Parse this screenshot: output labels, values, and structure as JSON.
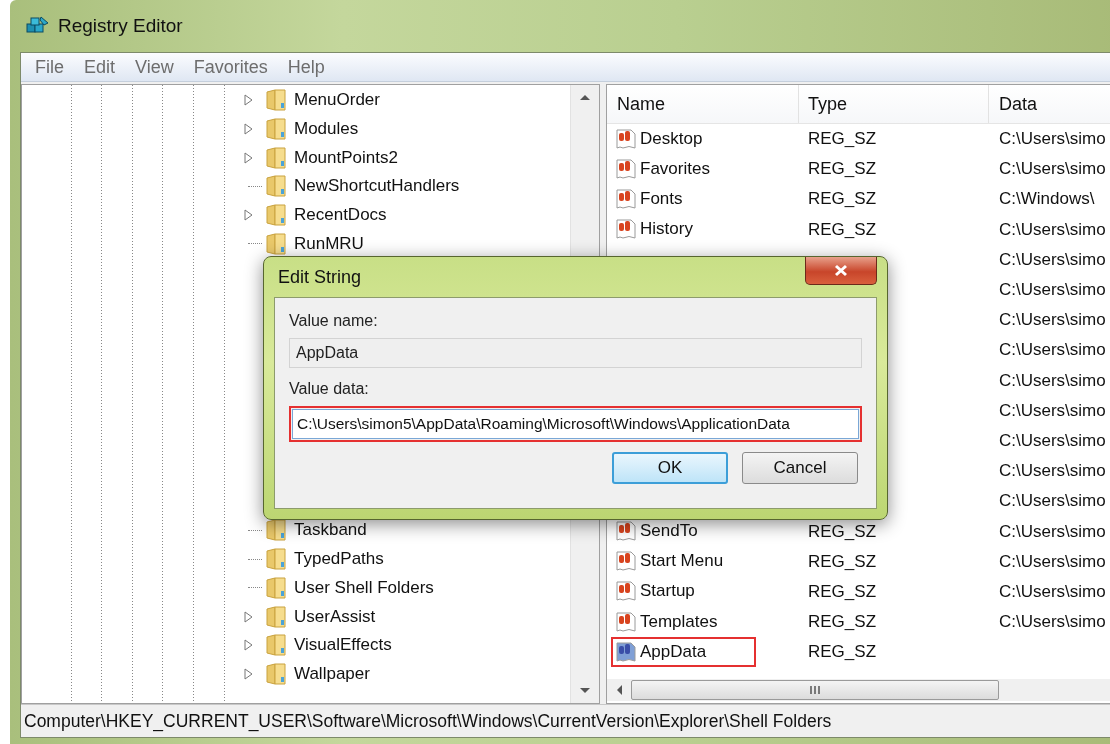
{
  "window": {
    "title": "Registry Editor"
  },
  "menu": [
    {
      "label": "File"
    },
    {
      "label": "Edit"
    },
    {
      "label": "View"
    },
    {
      "label": "Favorites"
    },
    {
      "label": "Help"
    }
  ],
  "tree": {
    "items_above": [
      {
        "label": "MenuOrder",
        "expandable": true
      },
      {
        "label": "Modules",
        "expandable": true
      },
      {
        "label": "MountPoints2",
        "expandable": true
      },
      {
        "label": "NewShortcutHandlers",
        "expandable": false
      },
      {
        "label": "RecentDocs",
        "expandable": true
      },
      {
        "label": "RunMRU",
        "expandable": false
      }
    ],
    "items_below": [
      {
        "label": "Taskband",
        "expandable": false
      },
      {
        "label": "TypedPaths",
        "expandable": false
      },
      {
        "label": "User Shell Folders",
        "expandable": false
      },
      {
        "label": "UserAssist",
        "expandable": true
      },
      {
        "label": "VisualEffects",
        "expandable": true
      },
      {
        "label": "Wallpaper",
        "expandable": true
      }
    ]
  },
  "list": {
    "columns": [
      "Name",
      "Type",
      "Data"
    ],
    "rows": [
      {
        "name": "Desktop",
        "type": "REG_SZ",
        "data": "C:\\Users\\simo",
        "selected": false,
        "highlighted": false
      },
      {
        "name": "Favorites",
        "type": "REG_SZ",
        "data": "C:\\Users\\simo",
        "selected": false,
        "highlighted": false
      },
      {
        "name": "Fonts",
        "type": "REG_SZ",
        "data": "C:\\Windows\\",
        "selected": false,
        "highlighted": false
      },
      {
        "name": "History",
        "type": "REG_SZ",
        "data": "C:\\Users\\simo",
        "selected": false,
        "highlighted": false
      },
      {
        "data": "C:\\Users\\simo"
      },
      {
        "data": "C:\\Users\\simo"
      },
      {
        "data": "C:\\Users\\simo"
      },
      {
        "data": "C:\\Users\\simo"
      },
      {
        "data": "C:\\Users\\simo"
      },
      {
        "data": "C:\\Users\\simo"
      },
      {
        "data": "C:\\Users\\simo"
      },
      {
        "data": "C:\\Users\\simo"
      },
      {
        "data": "C:\\Users\\simo"
      },
      {
        "name": "SendTo",
        "type": "REG_SZ",
        "data": "C:\\Users\\simo",
        "selected": false,
        "highlighted": false
      },
      {
        "name": "Start Menu",
        "type": "REG_SZ",
        "data": "C:\\Users\\simo",
        "selected": false,
        "highlighted": false
      },
      {
        "name": "Startup",
        "type": "REG_SZ",
        "data": "C:\\Users\\simo",
        "selected": false,
        "highlighted": false
      },
      {
        "name": "Templates",
        "type": "REG_SZ",
        "data": "C:\\Users\\simo",
        "selected": false,
        "highlighted": false
      },
      {
        "name": "AppData",
        "type": "REG_SZ",
        "selected": true,
        "highlighted": true
      }
    ]
  },
  "dialog": {
    "title": "Edit String",
    "value_name_label": "Value name:",
    "value_name": "AppData",
    "value_data_label": "Value data:",
    "value_data": "C:\\Users\\simon5\\AppData\\Roaming\\Microsoft\\Windows\\ApplicationData",
    "value_data_highlighted": true,
    "buttons": [
      {
        "label": "OK",
        "default": true
      },
      {
        "label": "Cancel",
        "default": false
      }
    ]
  },
  "status_bar": "Computer\\HKEY_CURRENT_USER\\Software\\Microsoft\\Windows\\CurrentVersion\\Explorer\\Shell Folders"
}
